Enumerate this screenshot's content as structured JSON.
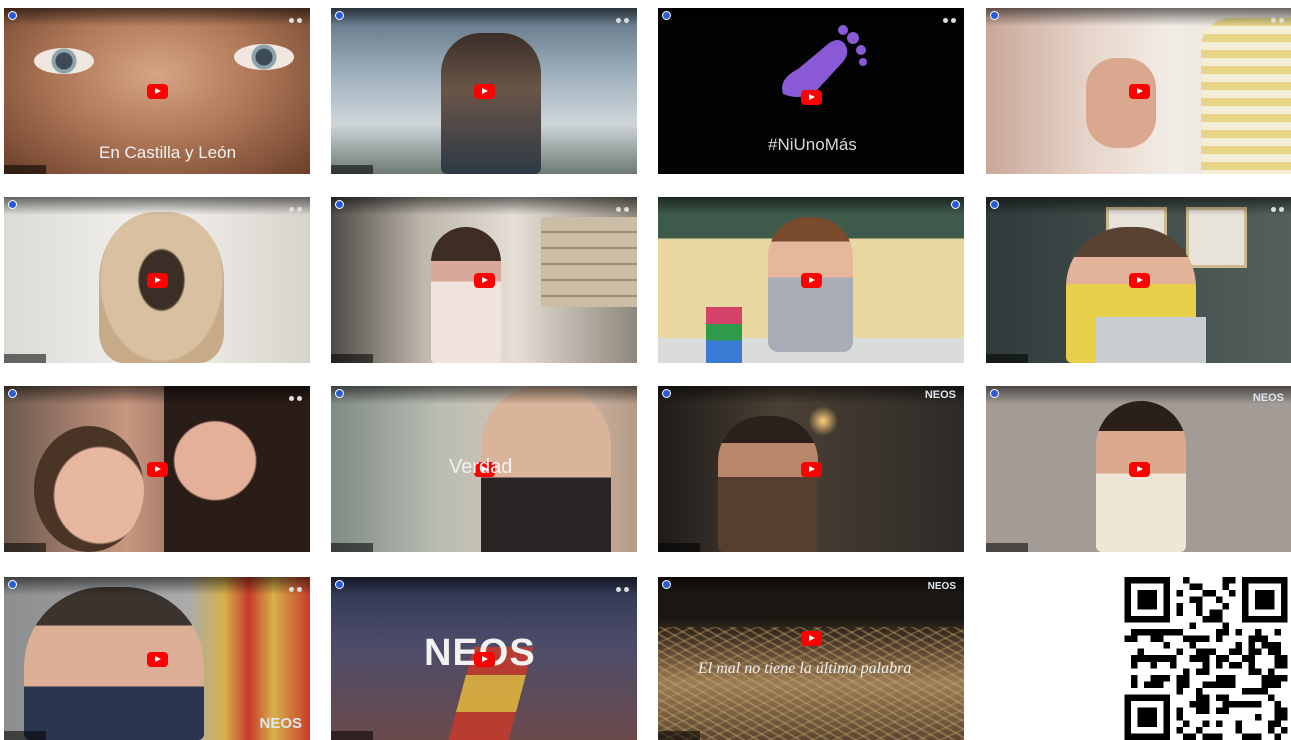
{
  "videos": [
    {
      "caption": "En Castilla y León",
      "title_icon": "channel-avatar-icon"
    },
    {
      "caption": ""
    },
    {
      "caption": "#NiUnoMás"
    },
    {
      "caption": ""
    },
    {
      "caption": ""
    },
    {
      "caption": ""
    },
    {
      "caption": ""
    },
    {
      "caption": ""
    },
    {
      "caption": ""
    },
    {
      "caption": "Verdad"
    },
    {
      "caption": "",
      "logo": "NEOS"
    },
    {
      "caption": "",
      "logo": "NEOS"
    },
    {
      "caption": "",
      "logo": "NEOS"
    },
    {
      "caption": "NEOS"
    },
    {
      "caption": "El mal no tiene la última palabra",
      "logo": "NEOS"
    }
  ],
  "colors": {
    "play_button": "#ff0000",
    "channel_avatar": "#2a5bd7"
  },
  "icons": {
    "play": "youtube-play-icon",
    "qr": "qr-code-icon"
  }
}
